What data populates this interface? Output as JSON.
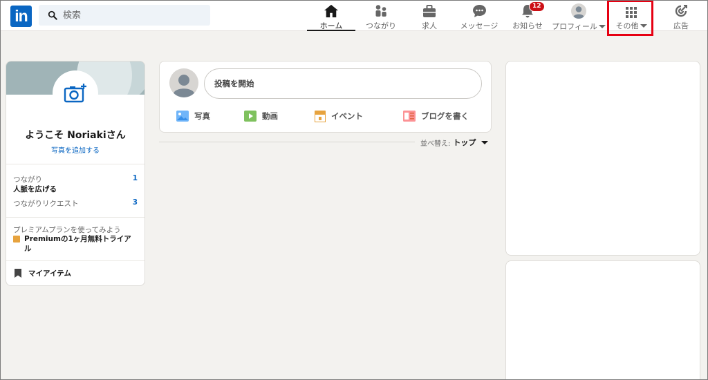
{
  "header": {
    "logo": "in",
    "search_placeholder": "検索",
    "nav": [
      {
        "label": "ホーム",
        "icon": "home-icon"
      },
      {
        "label": "つながり",
        "icon": "network-icon"
      },
      {
        "label": "求人",
        "icon": "briefcase-icon"
      },
      {
        "label": "メッセージ",
        "icon": "message-icon"
      },
      {
        "label": "お知らせ",
        "icon": "bell-icon",
        "badge": "12"
      },
      {
        "label": "プロフィール",
        "icon": "avatar-icon"
      },
      {
        "label": "その他",
        "icon": "grid-icon"
      },
      {
        "label": "広告",
        "icon": "ads-icon"
      }
    ]
  },
  "profile": {
    "welcome": "ようこそ Noriakiさん",
    "add_photo": "写真を追加する",
    "connections_label": "つながり",
    "connections_count": "1",
    "grow_network": "人脈を広げる",
    "requests_label": "つながりリクエスト",
    "requests_count": "3",
    "premium_note": "プレミアムプランを使ってみよう",
    "premium_link": "Premiumの1ヶ月無料トライアル",
    "my_items": "マイアイテム"
  },
  "share": {
    "start_post": "投稿を開始",
    "photo": "写真",
    "video": "動画",
    "event": "イベント",
    "article": "ブログを書く"
  },
  "feed": {
    "sort_label": "並べ替え:",
    "sort_value": "トップ"
  },
  "colors": {
    "brand": "#0a66c2",
    "badge": "#cc1016",
    "highlight": "#e60012"
  }
}
